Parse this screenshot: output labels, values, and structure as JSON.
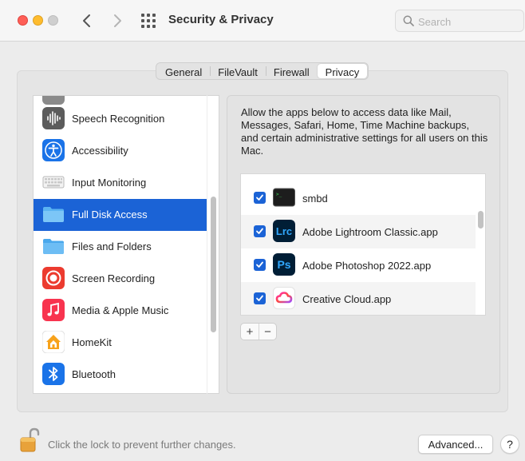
{
  "window": {
    "title": "Security & Privacy"
  },
  "search": {
    "placeholder": "Search",
    "value": ""
  },
  "tabs": [
    {
      "label": "General",
      "active": false
    },
    {
      "label": "FileVault",
      "active": false
    },
    {
      "label": "Firewall",
      "active": false
    },
    {
      "label": "Privacy",
      "active": true
    }
  ],
  "privacy_categories": [
    {
      "label": "Speech Recognition",
      "icon": "waveform-icon",
      "selected": false
    },
    {
      "label": "Accessibility",
      "icon": "accessibility-icon",
      "selected": false
    },
    {
      "label": "Input Monitoring",
      "icon": "keyboard-icon",
      "selected": false
    },
    {
      "label": "Full Disk Access",
      "icon": "folder-icon",
      "selected": true
    },
    {
      "label": "Files and Folders",
      "icon": "folder-icon",
      "selected": false
    },
    {
      "label": "Screen Recording",
      "icon": "screen-recording-icon",
      "selected": false
    },
    {
      "label": "Media & Apple Music",
      "icon": "music-note-icon",
      "selected": false
    },
    {
      "label": "HomeKit",
      "icon": "home-icon",
      "selected": false
    },
    {
      "label": "Bluetooth",
      "icon": "bluetooth-icon",
      "selected": false
    }
  ],
  "description": "Allow the apps below to access data like Mail, Messages, Safari, Home, Time Machine backups, and certain administrative settings for all users on this Mac.",
  "apps": [
    {
      "name": "smbd",
      "icon": "terminal-icon",
      "checked": true
    },
    {
      "name": "Adobe Lightroom Classic.app",
      "icon": "lightroom-icon",
      "icon_text": "Lrc",
      "checked": true
    },
    {
      "name": "Adobe Photoshop 2022.app",
      "icon": "photoshop-icon",
      "icon_text": "Ps",
      "checked": true
    },
    {
      "name": "Creative Cloud.app",
      "icon": "creative-cloud-icon",
      "checked": true
    }
  ],
  "controls": {
    "add": "+",
    "remove": "−"
  },
  "footer": {
    "lock_text": "Click the lock to prevent further changes.",
    "advanced_label": "Advanced...",
    "help_label": "?"
  },
  "colors": {
    "accent": "#1b63d6",
    "lightroom": "#001e36",
    "lightroom_text": "#31a8ff",
    "photoshop": "#001e36",
    "photoshop_text": "#31a8ff"
  }
}
